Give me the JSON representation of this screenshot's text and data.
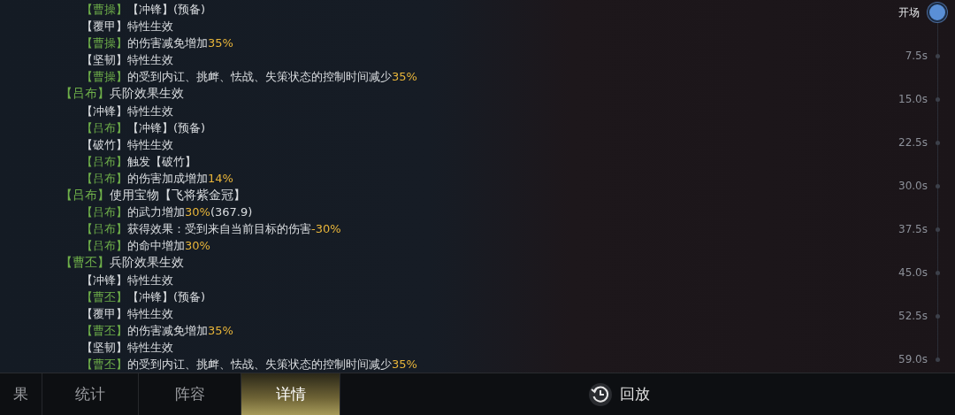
{
  "log": [
    {
      "children": [
        {
          "segments": [
            {
              "kind": "name",
              "text": "【曹操】"
            },
            {
              "kind": "text",
              "text": "【冲锋】(预备)"
            }
          ]
        },
        {
          "segments": [
            {
              "kind": "text",
              "text": "【覆甲】特性生效"
            }
          ]
        },
        {
          "segments": [
            {
              "kind": "name",
              "text": "【曹操】"
            },
            {
              "kind": "text",
              "text": "的伤害减免增加"
            },
            {
              "kind": "value",
              "text": "35%"
            }
          ]
        },
        {
          "segments": [
            {
              "kind": "text",
              "text": "【坚韧】特性生效"
            }
          ]
        },
        {
          "segments": [
            {
              "kind": "name",
              "text": "【曹操】"
            },
            {
              "kind": "text",
              "text": "的受到内讧、挑衅、怯战、失策状态的控制时间减少"
            },
            {
              "kind": "value",
              "text": "35%"
            }
          ]
        }
      ]
    },
    {
      "segments": [
        {
          "kind": "name",
          "text": "【吕布】"
        },
        {
          "kind": "text",
          "text": "兵阶效果生效"
        }
      ],
      "children": [
        {
          "segments": [
            {
              "kind": "text",
              "text": "【冲锋】特性生效"
            }
          ]
        },
        {
          "segments": [
            {
              "kind": "name",
              "text": "【吕布】"
            },
            {
              "kind": "text",
              "text": "【冲锋】(预备)"
            }
          ]
        },
        {
          "segments": [
            {
              "kind": "text",
              "text": "【破竹】特性生效"
            }
          ]
        },
        {
          "segments": [
            {
              "kind": "name",
              "text": "【吕布】"
            },
            {
              "kind": "text",
              "text": "触发【破竹】"
            }
          ]
        },
        {
          "segments": [
            {
              "kind": "name",
              "text": "【吕布】"
            },
            {
              "kind": "text",
              "text": "的伤害加成增加"
            },
            {
              "kind": "value",
              "text": "14%"
            }
          ]
        }
      ]
    },
    {
      "segments": [
        {
          "kind": "name",
          "text": "【吕布】"
        },
        {
          "kind": "text",
          "text": "使用宝物【飞将紫金冠】"
        }
      ],
      "children": [
        {
          "segments": [
            {
              "kind": "name",
              "text": "【吕布】"
            },
            {
              "kind": "text",
              "text": "的武力增加"
            },
            {
              "kind": "value",
              "text": "30%"
            },
            {
              "kind": "text",
              "text": "(367.9)"
            }
          ]
        },
        {
          "segments": [
            {
              "kind": "name",
              "text": "【吕布】"
            },
            {
              "kind": "text",
              "text": "获得效果：受到来自当前目标的伤害"
            },
            {
              "kind": "value",
              "text": "-30%"
            }
          ]
        },
        {
          "segments": [
            {
              "kind": "name",
              "text": "【吕布】"
            },
            {
              "kind": "text",
              "text": "的命中增加"
            },
            {
              "kind": "value",
              "text": "30%"
            }
          ]
        }
      ]
    },
    {
      "segments": [
        {
          "kind": "name",
          "text": "【曹丕】"
        },
        {
          "kind": "text",
          "text": "兵阶效果生效"
        }
      ],
      "children": [
        {
          "segments": [
            {
              "kind": "text",
              "text": "【冲锋】特性生效"
            }
          ]
        },
        {
          "segments": [
            {
              "kind": "name",
              "text": "【曹丕】"
            },
            {
              "kind": "text",
              "text": "【冲锋】(预备)"
            }
          ]
        },
        {
          "segments": [
            {
              "kind": "text",
              "text": "【覆甲】特性生效"
            }
          ]
        },
        {
          "segments": [
            {
              "kind": "name",
              "text": "【曹丕】"
            },
            {
              "kind": "text",
              "text": "的伤害减免增加"
            },
            {
              "kind": "value",
              "text": "35%"
            }
          ]
        },
        {
          "segments": [
            {
              "kind": "text",
              "text": "【坚韧】特性生效"
            }
          ]
        },
        {
          "segments": [
            {
              "kind": "name",
              "text": "【曹丕】"
            },
            {
              "kind": "text",
              "text": "的受到内讧、挑衅、怯战、失策状态的控制时间减少"
            },
            {
              "kind": "value",
              "text": "35%"
            }
          ]
        }
      ]
    }
  ],
  "timeline": [
    {
      "label": "开场",
      "selected": true
    },
    {
      "label": "7.5s",
      "selected": false
    },
    {
      "label": "15.0s",
      "selected": false
    },
    {
      "label": "22.5s",
      "selected": false
    },
    {
      "label": "30.0s",
      "selected": false
    },
    {
      "label": "37.5s",
      "selected": false
    },
    {
      "label": "45.0s",
      "selected": false
    },
    {
      "label": "52.5s",
      "selected": false
    },
    {
      "label": "59.0s",
      "selected": false
    }
  ],
  "tabs": [
    {
      "label": "果",
      "selected": false
    },
    {
      "label": "统计",
      "selected": false
    },
    {
      "label": "阵容",
      "selected": false
    },
    {
      "label": "详情",
      "selected": true
    }
  ],
  "replay_button": {
    "label": "回放"
  }
}
